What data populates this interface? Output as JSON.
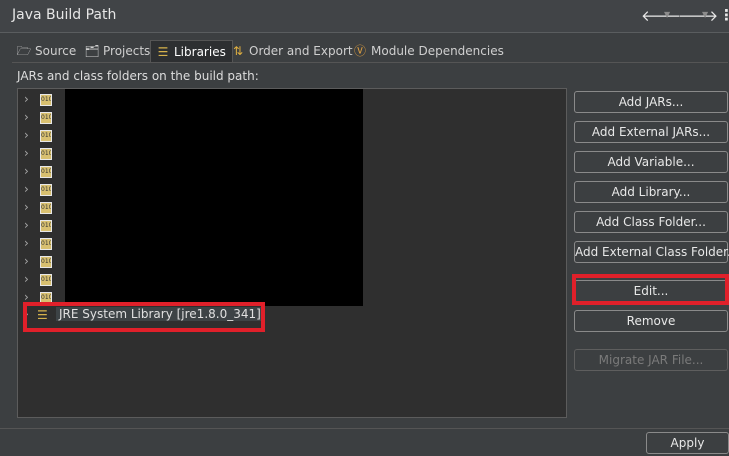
{
  "window": {
    "title": "Java Build Path"
  },
  "tabs": [
    {
      "label": "Source",
      "icon": "source-folder-icon",
      "active": false
    },
    {
      "label": "Projects",
      "icon": "projects-folder-icon",
      "active": false
    },
    {
      "label": "Libraries",
      "icon": "libraries-icon",
      "active": true
    },
    {
      "label": "Order and Export",
      "icon": "order-export-icon",
      "active": false
    },
    {
      "label": "Module Dependencies",
      "icon": "module-icon",
      "active": false
    }
  ],
  "section_label": "JARs and class folders on the build path:",
  "tree": {
    "jar_icon_text": "010",
    "jar_count": 12,
    "jre_label": "JRE System Library [jre1.8.0_341]"
  },
  "buttons": {
    "add_jars": "Add JARs...",
    "add_external_jars": "Add External JARs...",
    "add_variable": "Add Variable...",
    "add_library": "Add Library...",
    "add_class_folder": "Add Class Folder...",
    "add_external_class_folder": "Add External Class Folder...",
    "edit": "Edit...",
    "remove": "Remove",
    "migrate_jar": "Migrate JAR File...",
    "apply": "Apply"
  },
  "colors": {
    "highlight": "#e0202a",
    "background": "#3c3f41"
  }
}
